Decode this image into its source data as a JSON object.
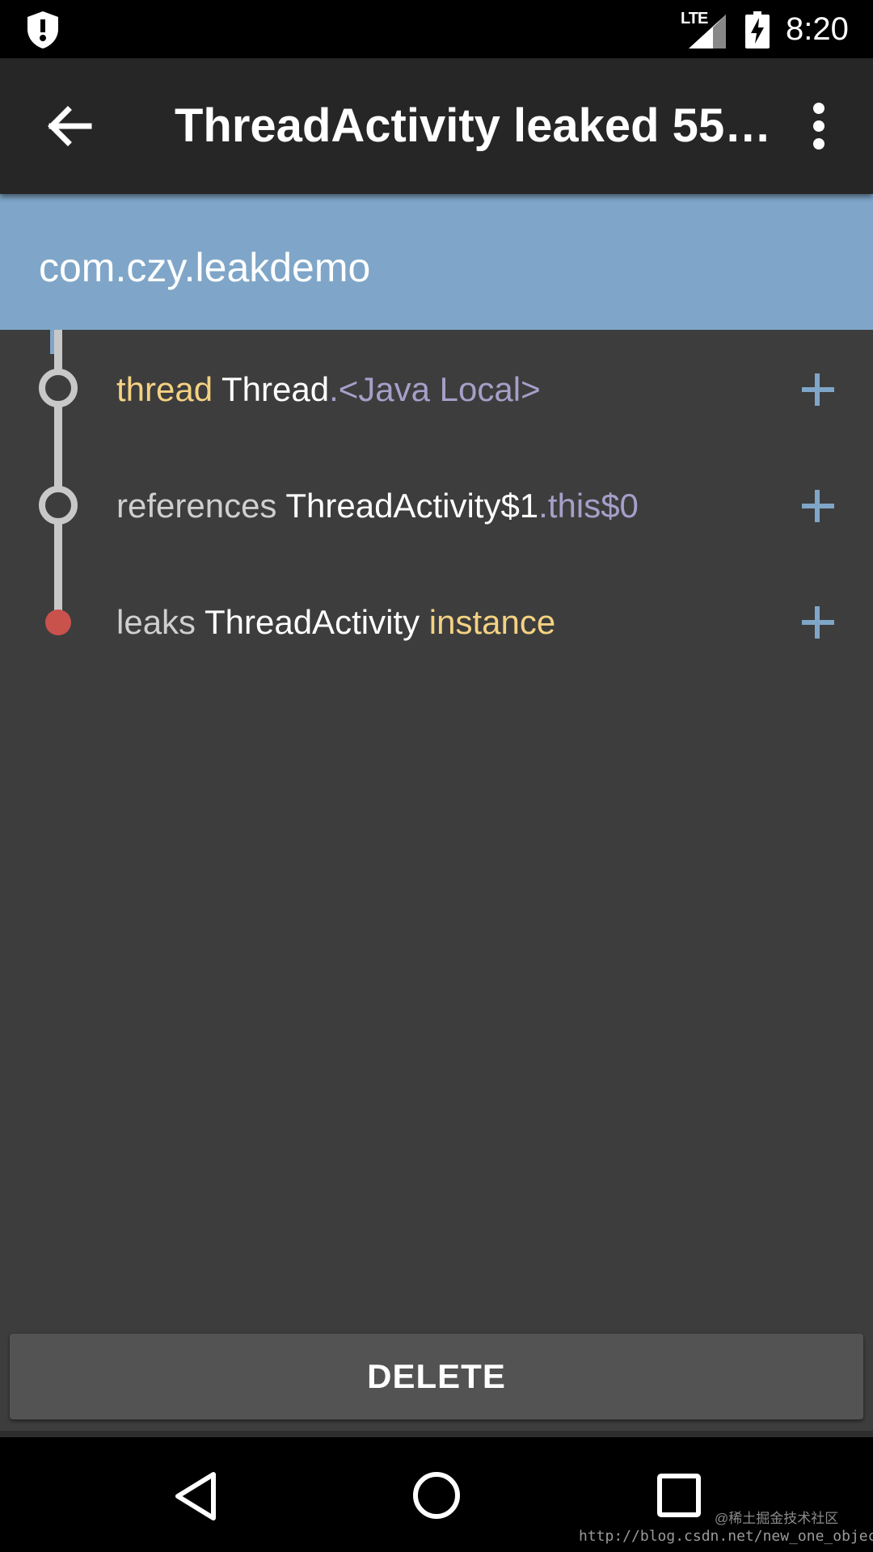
{
  "status_bar": {
    "network": "LTE",
    "time": "8:20",
    "icons": [
      "shield-icon",
      "signal-icon",
      "battery-charging-icon"
    ]
  },
  "toolbar": {
    "title": "ThreadActivity leaked 55…",
    "icons": [
      "arrow-back-icon",
      "more-vert-icon"
    ]
  },
  "header": {
    "package": "com.czy.leakdemo",
    "color": "#7fa6c8"
  },
  "leak_trace": [
    {
      "prefix": "thread",
      "class": "Thread",
      "suffix": ".<Java Local>",
      "node": "open-circle"
    },
    {
      "prefix": "references",
      "class": "ThreadActivity$1",
      "suffix": ".this$0",
      "node": "open-circle"
    },
    {
      "prefix": "leaks",
      "class": "ThreadActivity",
      "suffix": "instance",
      "node": "red-dot"
    }
  ],
  "delete_button": {
    "label": "DELETE"
  },
  "watermark": {
    "line1": "@稀土掘金技术社区",
    "line2": "http://blog.csdn.net/new_one_object"
  },
  "colors": {
    "background": "#3d3d3d",
    "toolbar": "#262626",
    "accent_yellow": "#f4d283",
    "accent_purple": "#a79fc9",
    "plus_blue": "#7fa6c8",
    "leak_red": "#c9524d"
  }
}
